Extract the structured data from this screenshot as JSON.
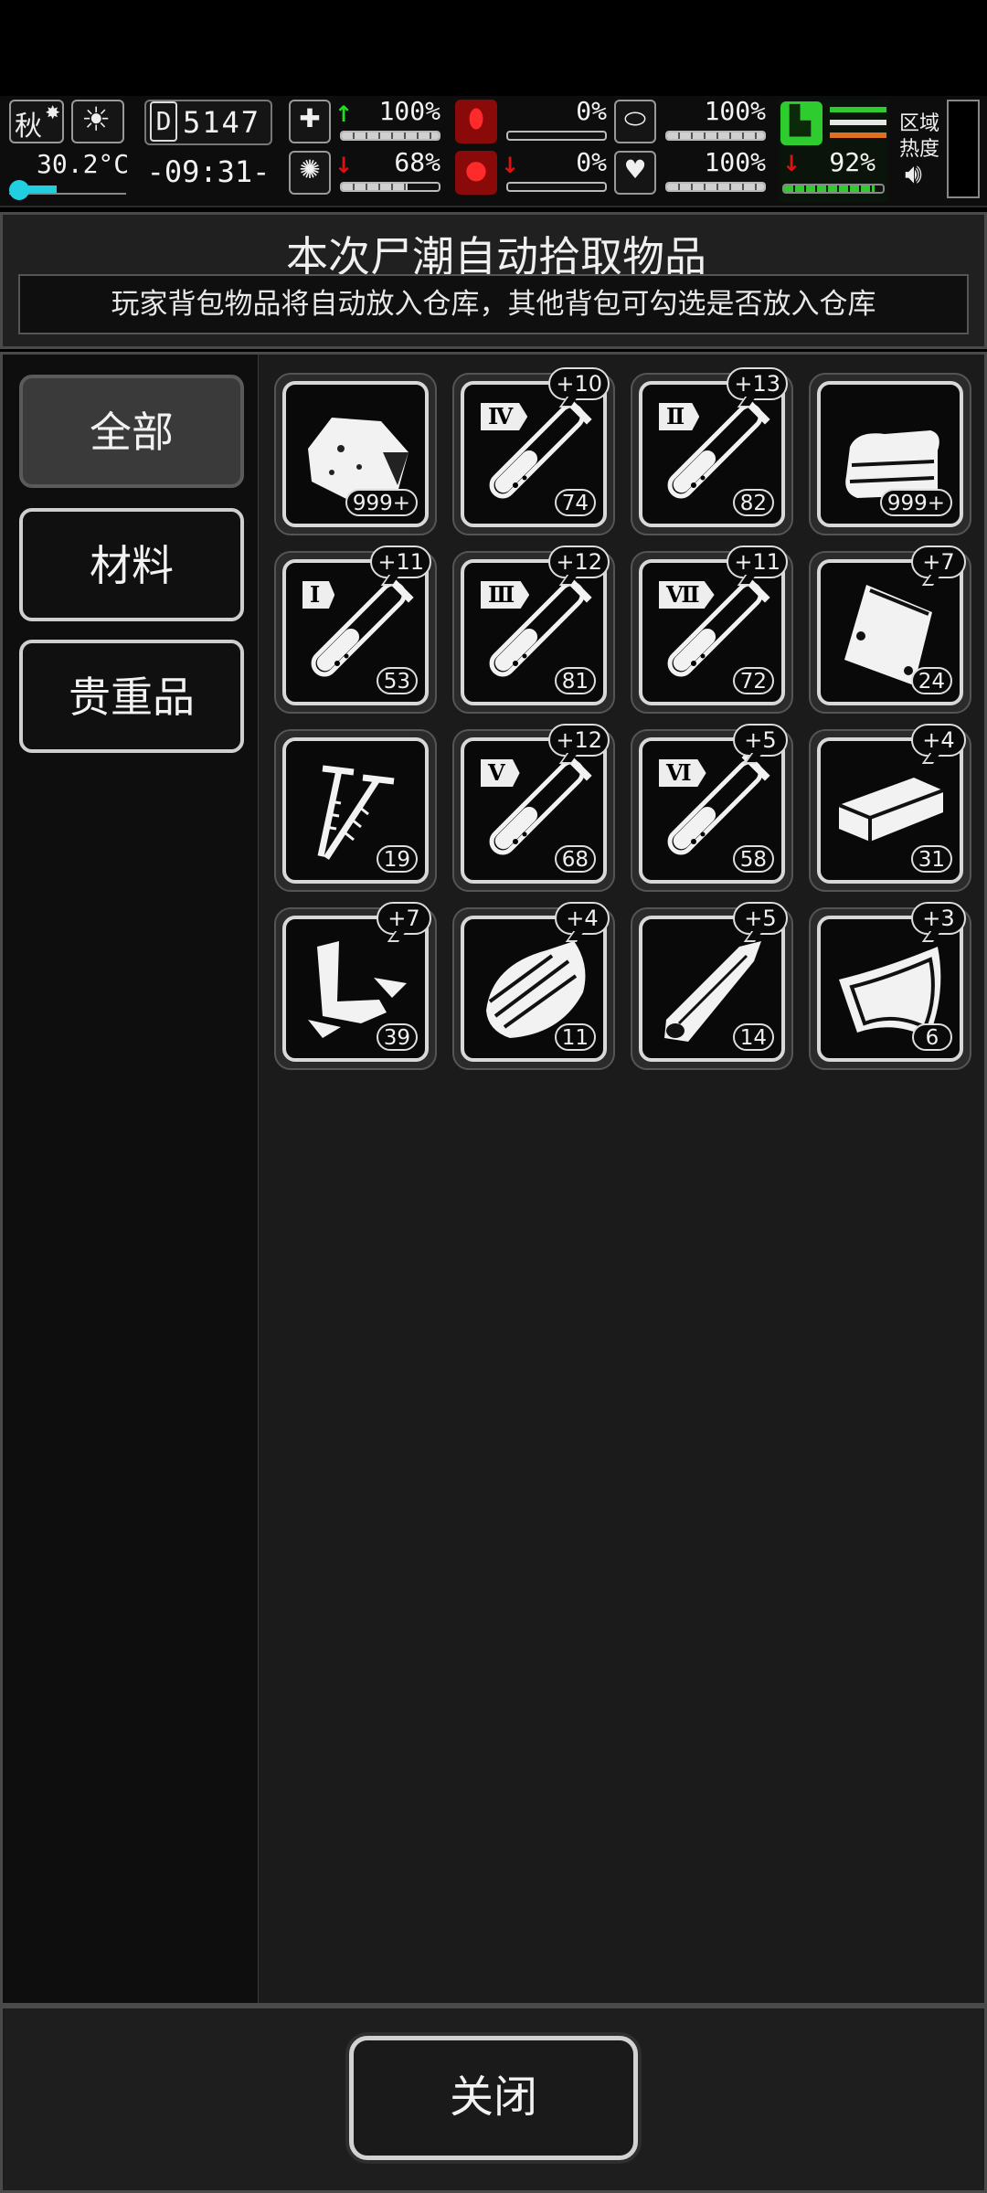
{
  "hud": {
    "season": "秋",
    "weather_icon": "sun-icon",
    "temperature": "30.2°C",
    "day": "5147",
    "time": "-09:31-",
    "stats": [
      {
        "icon": "medkit-icon",
        "arrow": "up",
        "value": "100%",
        "fill": 1.0,
        "color": "#d0d0d0"
      },
      {
        "icon": "stomach-icon",
        "arrow": "",
        "value": "0%",
        "fill": 0.0,
        "color": "#d0d0d0"
      },
      {
        "icon": "pill-icon",
        "arrow": "",
        "value": "100%",
        "fill": 1.0,
        "color": "#d0d0d0"
      },
      {
        "icon": "brain-icon",
        "arrow": "down",
        "value": "68%",
        "fill": 0.68,
        "color": "#d0d0d0"
      },
      {
        "icon": "blood-drop-icon",
        "arrow": "down",
        "value": "0%",
        "fill": 0.0,
        "color": "#d0d0d0"
      },
      {
        "icon": "heart-icon",
        "arrow": "",
        "value": "100%",
        "fill": 1.0,
        "color": "#d0d0d0"
      }
    ],
    "stamina": {
      "icon": "boot-icon",
      "arrow": "down",
      "value": "92%",
      "fill": 0.92,
      "color": "#2ecc2e"
    },
    "region_label_1": "区域",
    "region_label_2": "热度",
    "sound_icon": "speaker-icon",
    "colors": {
      "up": "#22dd22",
      "down": "#e01010",
      "accent_red": "#cc1111",
      "accent_green": "#2ecc2e",
      "accent_orange": "#e07020",
      "cyan": "#20d0e0"
    }
  },
  "dialog": {
    "title": "本次尸潮自动拾取物品",
    "subtitle": "玩家背包物品将自动放入仓库，其他背包可勾选是否放入仓库",
    "tabs": [
      "全部",
      "材料",
      "贵重品"
    ],
    "active_tab": 0,
    "close_label": "关闭"
  },
  "items": [
    {
      "icon": "meat-icon",
      "roman": "",
      "bonus": "",
      "count": "999+"
    },
    {
      "icon": "test-tube-icon",
      "roman": "Ⅳ",
      "bonus": "+10",
      "count": "74"
    },
    {
      "icon": "test-tube-icon",
      "roman": "Ⅱ",
      "bonus": "+13",
      "count": "82"
    },
    {
      "icon": "cloth-icon",
      "roman": "",
      "bonus": "",
      "count": "999+"
    },
    {
      "icon": "test-tube-icon",
      "roman": "Ⅰ",
      "bonus": "+11",
      "count": "53"
    },
    {
      "icon": "test-tube-icon",
      "roman": "Ⅲ",
      "bonus": "+12",
      "count": "81"
    },
    {
      "icon": "test-tube-icon",
      "roman": "Ⅶ",
      "bonus": "+11",
      "count": "72"
    },
    {
      "icon": "bag-icon",
      "roman": "",
      "bonus": "+7",
      "count": "24"
    },
    {
      "icon": "screws-icon",
      "roman": "",
      "bonus": "",
      "count": "19"
    },
    {
      "icon": "test-tube-icon",
      "roman": "Ⅴ",
      "bonus": "+12",
      "count": "68"
    },
    {
      "icon": "test-tube-icon",
      "roman": "Ⅵ",
      "bonus": "+5",
      "count": "58"
    },
    {
      "icon": "wood-plank-icon",
      "roman": "",
      "bonus": "+4",
      "count": "31"
    },
    {
      "icon": "scrap-metal-icon",
      "roman": "",
      "bonus": "+7",
      "count": "39"
    },
    {
      "icon": "wood-log-icon",
      "roman": "",
      "bonus": "+4",
      "count": "11"
    },
    {
      "icon": "branch-icon",
      "roman": "",
      "bonus": "+5",
      "count": "14"
    },
    {
      "icon": "leather-icon",
      "roman": "",
      "bonus": "+3",
      "count": "6"
    }
  ]
}
